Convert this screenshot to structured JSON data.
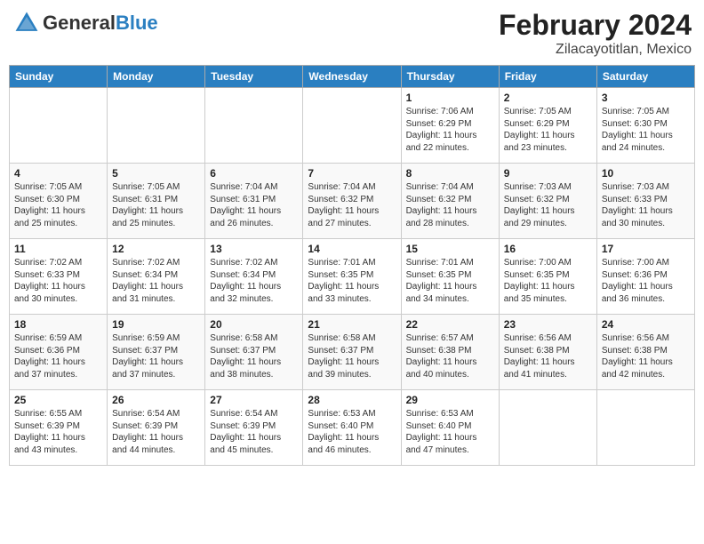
{
  "header": {
    "logo_general": "General",
    "logo_blue": "Blue",
    "month_year": "February 2024",
    "location": "Zilacayotitlan, Mexico"
  },
  "days_of_week": [
    "Sunday",
    "Monday",
    "Tuesday",
    "Wednesday",
    "Thursday",
    "Friday",
    "Saturday"
  ],
  "weeks": [
    [
      {
        "day": "",
        "sunrise": "",
        "sunset": "",
        "daylight": ""
      },
      {
        "day": "",
        "sunrise": "",
        "sunset": "",
        "daylight": ""
      },
      {
        "day": "",
        "sunrise": "",
        "sunset": "",
        "daylight": ""
      },
      {
        "day": "",
        "sunrise": "",
        "sunset": "",
        "daylight": ""
      },
      {
        "day": "1",
        "sunrise": "Sunrise: 7:06 AM",
        "sunset": "Sunset: 6:29 PM",
        "daylight": "Daylight: 11 hours and 22 minutes."
      },
      {
        "day": "2",
        "sunrise": "Sunrise: 7:05 AM",
        "sunset": "Sunset: 6:29 PM",
        "daylight": "Daylight: 11 hours and 23 minutes."
      },
      {
        "day": "3",
        "sunrise": "Sunrise: 7:05 AM",
        "sunset": "Sunset: 6:30 PM",
        "daylight": "Daylight: 11 hours and 24 minutes."
      }
    ],
    [
      {
        "day": "4",
        "sunrise": "Sunrise: 7:05 AM",
        "sunset": "Sunset: 6:30 PM",
        "daylight": "Daylight: 11 hours and 25 minutes."
      },
      {
        "day": "5",
        "sunrise": "Sunrise: 7:05 AM",
        "sunset": "Sunset: 6:31 PM",
        "daylight": "Daylight: 11 hours and 25 minutes."
      },
      {
        "day": "6",
        "sunrise": "Sunrise: 7:04 AM",
        "sunset": "Sunset: 6:31 PM",
        "daylight": "Daylight: 11 hours and 26 minutes."
      },
      {
        "day": "7",
        "sunrise": "Sunrise: 7:04 AM",
        "sunset": "Sunset: 6:32 PM",
        "daylight": "Daylight: 11 hours and 27 minutes."
      },
      {
        "day": "8",
        "sunrise": "Sunrise: 7:04 AM",
        "sunset": "Sunset: 6:32 PM",
        "daylight": "Daylight: 11 hours and 28 minutes."
      },
      {
        "day": "9",
        "sunrise": "Sunrise: 7:03 AM",
        "sunset": "Sunset: 6:32 PM",
        "daylight": "Daylight: 11 hours and 29 minutes."
      },
      {
        "day": "10",
        "sunrise": "Sunrise: 7:03 AM",
        "sunset": "Sunset: 6:33 PM",
        "daylight": "Daylight: 11 hours and 30 minutes."
      }
    ],
    [
      {
        "day": "11",
        "sunrise": "Sunrise: 7:02 AM",
        "sunset": "Sunset: 6:33 PM",
        "daylight": "Daylight: 11 hours and 30 minutes."
      },
      {
        "day": "12",
        "sunrise": "Sunrise: 7:02 AM",
        "sunset": "Sunset: 6:34 PM",
        "daylight": "Daylight: 11 hours and 31 minutes."
      },
      {
        "day": "13",
        "sunrise": "Sunrise: 7:02 AM",
        "sunset": "Sunset: 6:34 PM",
        "daylight": "Daylight: 11 hours and 32 minutes."
      },
      {
        "day": "14",
        "sunrise": "Sunrise: 7:01 AM",
        "sunset": "Sunset: 6:35 PM",
        "daylight": "Daylight: 11 hours and 33 minutes."
      },
      {
        "day": "15",
        "sunrise": "Sunrise: 7:01 AM",
        "sunset": "Sunset: 6:35 PM",
        "daylight": "Daylight: 11 hours and 34 minutes."
      },
      {
        "day": "16",
        "sunrise": "Sunrise: 7:00 AM",
        "sunset": "Sunset: 6:35 PM",
        "daylight": "Daylight: 11 hours and 35 minutes."
      },
      {
        "day": "17",
        "sunrise": "Sunrise: 7:00 AM",
        "sunset": "Sunset: 6:36 PM",
        "daylight": "Daylight: 11 hours and 36 minutes."
      }
    ],
    [
      {
        "day": "18",
        "sunrise": "Sunrise: 6:59 AM",
        "sunset": "Sunset: 6:36 PM",
        "daylight": "Daylight: 11 hours and 37 minutes."
      },
      {
        "day": "19",
        "sunrise": "Sunrise: 6:59 AM",
        "sunset": "Sunset: 6:37 PM",
        "daylight": "Daylight: 11 hours and 37 minutes."
      },
      {
        "day": "20",
        "sunrise": "Sunrise: 6:58 AM",
        "sunset": "Sunset: 6:37 PM",
        "daylight": "Daylight: 11 hours and 38 minutes."
      },
      {
        "day": "21",
        "sunrise": "Sunrise: 6:58 AM",
        "sunset": "Sunset: 6:37 PM",
        "daylight": "Daylight: 11 hours and 39 minutes."
      },
      {
        "day": "22",
        "sunrise": "Sunrise: 6:57 AM",
        "sunset": "Sunset: 6:38 PM",
        "daylight": "Daylight: 11 hours and 40 minutes."
      },
      {
        "day": "23",
        "sunrise": "Sunrise: 6:56 AM",
        "sunset": "Sunset: 6:38 PM",
        "daylight": "Daylight: 11 hours and 41 minutes."
      },
      {
        "day": "24",
        "sunrise": "Sunrise: 6:56 AM",
        "sunset": "Sunset: 6:38 PM",
        "daylight": "Daylight: 11 hours and 42 minutes."
      }
    ],
    [
      {
        "day": "25",
        "sunrise": "Sunrise: 6:55 AM",
        "sunset": "Sunset: 6:39 PM",
        "daylight": "Daylight: 11 hours and 43 minutes."
      },
      {
        "day": "26",
        "sunrise": "Sunrise: 6:54 AM",
        "sunset": "Sunset: 6:39 PM",
        "daylight": "Daylight: 11 hours and 44 minutes."
      },
      {
        "day": "27",
        "sunrise": "Sunrise: 6:54 AM",
        "sunset": "Sunset: 6:39 PM",
        "daylight": "Daylight: 11 hours and 45 minutes."
      },
      {
        "day": "28",
        "sunrise": "Sunrise: 6:53 AM",
        "sunset": "Sunset: 6:40 PM",
        "daylight": "Daylight: 11 hours and 46 minutes."
      },
      {
        "day": "29",
        "sunrise": "Sunrise: 6:53 AM",
        "sunset": "Sunset: 6:40 PM",
        "daylight": "Daylight: 11 hours and 47 minutes."
      },
      {
        "day": "",
        "sunrise": "",
        "sunset": "",
        "daylight": ""
      },
      {
        "day": "",
        "sunrise": "",
        "sunset": "",
        "daylight": ""
      }
    ]
  ]
}
